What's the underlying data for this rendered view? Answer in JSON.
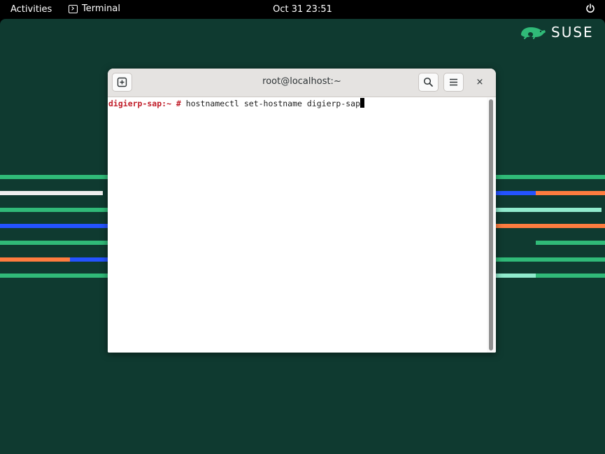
{
  "topbar": {
    "activities": "Activities",
    "app_name": "Terminal",
    "app_icon": "terminal-icon",
    "clock": "Oct 31  23:51",
    "power_icon": "power-icon"
  },
  "desktop": {
    "logo_text": "SUSE",
    "logo_icon": "chameleon-icon",
    "colors": {
      "background": "#0f3a30",
      "green": "#30ba78",
      "blue": "#2453ff",
      "orange": "#fe7c3f",
      "mint": "#90ebcd",
      "white": "#efefef"
    }
  },
  "window": {
    "title": "root@localhost:~",
    "new_tab_icon": "new-tab-icon",
    "search_icon": "search-icon",
    "menu_icon": "hamburger-menu-icon",
    "close_label": "×",
    "terminal": {
      "prompt": "digierp-sap:~ #",
      "command": " hostnamectl set-hostname digierp-sap"
    }
  }
}
